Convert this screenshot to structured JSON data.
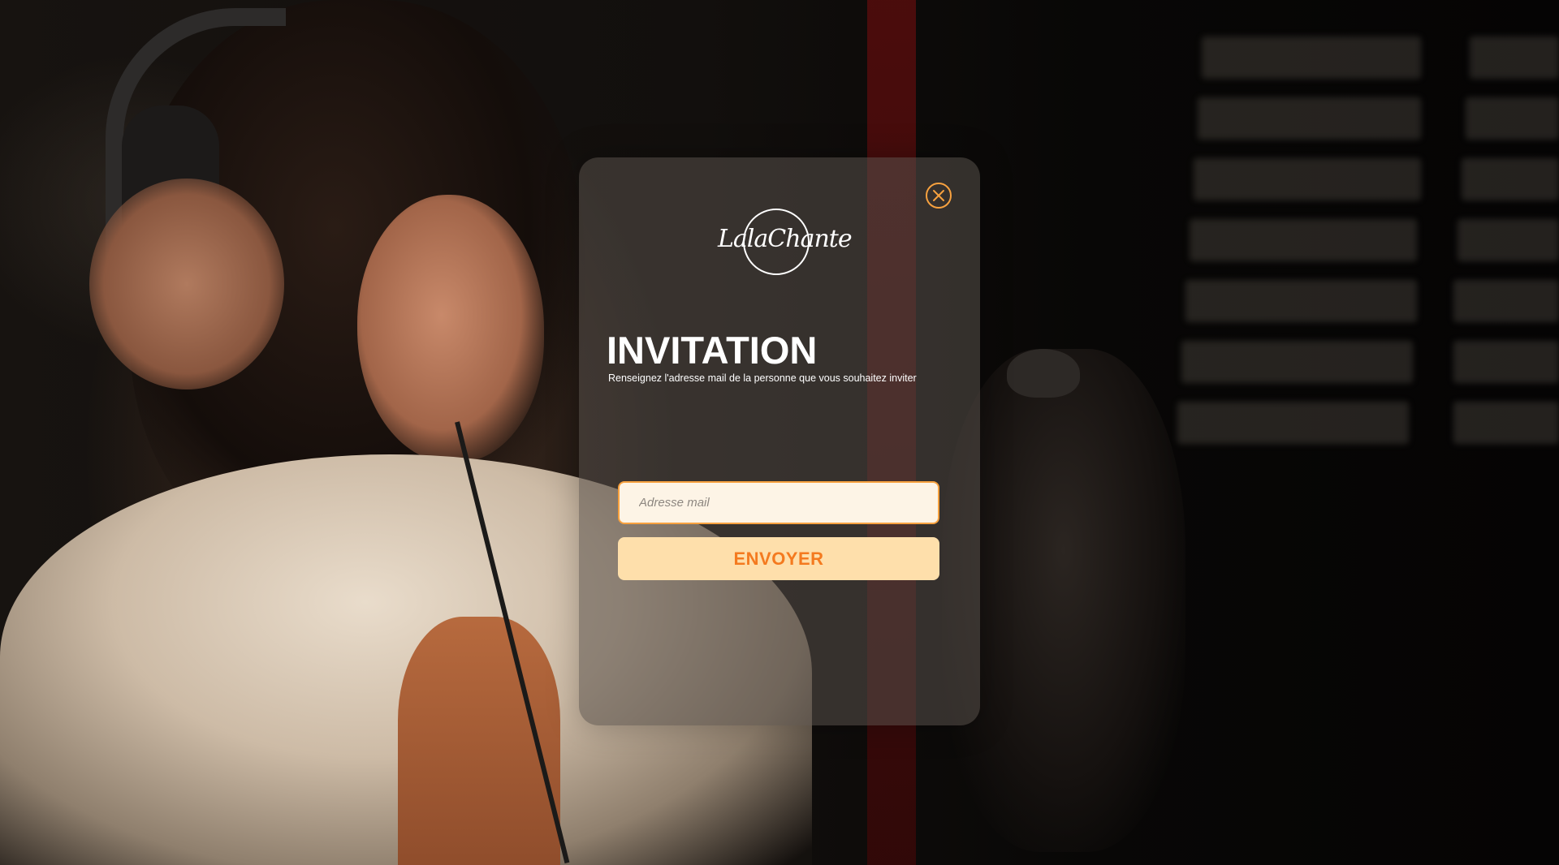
{
  "brand": {
    "logo_text": "LalaChante"
  },
  "modal": {
    "title": "INVITATION",
    "subtitle": "Renseignez l'adresse mail de la personne que vous souhaitez inviter",
    "email": {
      "placeholder": "Adresse mail",
      "value": ""
    },
    "submit_label": "ENVOYER",
    "close_icon": "close-icon"
  },
  "colors": {
    "accent": "#f7a13f",
    "button_bg": "#fedfab",
    "button_text": "#f47a1f",
    "input_bg": "#fdf4e6",
    "modal_bg": "rgba(88,80,74,0.55)"
  }
}
